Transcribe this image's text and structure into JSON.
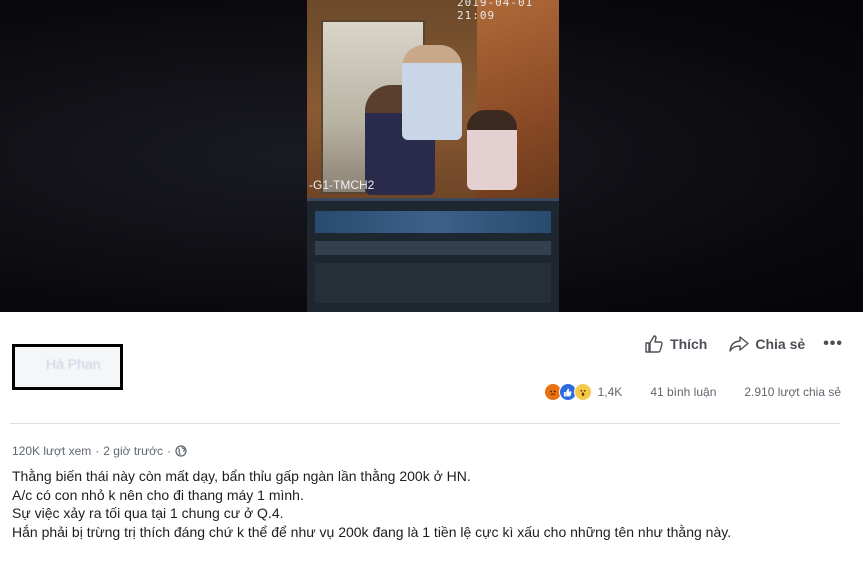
{
  "video": {
    "timestamp": "2019-04-01 21:09",
    "camera_label": "-G1-TMCH2"
  },
  "author": {
    "name": "Hà Phan"
  },
  "actions": {
    "like_label": "Thích",
    "share_label": "Chia sẻ",
    "more_label": "•••"
  },
  "stats": {
    "reaction_count": "1,4K",
    "comments": "41 bình luận",
    "shares": "2.910 lượt chia sẻ",
    "reaction_icons": [
      "angry-reaction",
      "like-reaction",
      "wow-reaction"
    ]
  },
  "meta": {
    "views": "120K lượt xem",
    "time": "2 giờ trước",
    "separator": "·"
  },
  "post": {
    "lines": [
      "Thằng biến thái này còn mất dạy, bẩn thỉu gấp ngàn lần thằng 200k ở HN.",
      "A/c có con nhỏ k nên cho đi thang máy 1 mình.",
      "Sự việc xảy ra tối qua tại 1 chung cư ở Q.4.",
      "Hắn phải bị trừng trị thích đáng chứ k thể để như vụ 200k đang là 1 tiền lệ cực kì xấu cho những tên như thằng này."
    ]
  },
  "colors": {
    "text_primary": "#1c1e21",
    "text_secondary": "#606770",
    "like_blue": "#2d6cdf",
    "angry_orange": "#e9710f",
    "wow_yellow": "#f7c948"
  }
}
